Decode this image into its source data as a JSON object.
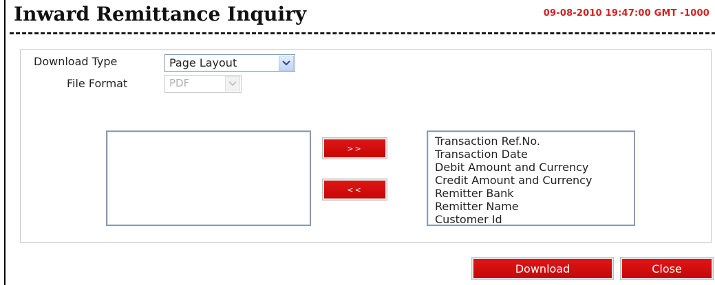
{
  "header": {
    "title": "Inward Remittance Inquiry",
    "datetime": "09-08-2010 19:47:00 GMT -1000"
  },
  "form": {
    "download_type": {
      "label": "Download Type",
      "value": "Page Layout"
    },
    "file_format": {
      "label": "File Format",
      "value": "PDF",
      "disabled": true
    }
  },
  "columns": {
    "available": [],
    "selected": [
      "Transaction Ref.No.",
      "Transaction Date",
      "Debit Amount and Currency",
      "Credit Amount and Currency",
      "Remitter Bank",
      "Remitter Name",
      "Customer Id"
    ],
    "add_label": ">>",
    "remove_label": "<<"
  },
  "actions": {
    "download_label": "Download",
    "close_label": "Close"
  },
  "colors": {
    "accent": "#d40f0f",
    "title": "#111111",
    "datetime": "#d42020",
    "select_border": "#7f9db9"
  },
  "icons": {
    "dropdown": "chevron-down-icon"
  }
}
